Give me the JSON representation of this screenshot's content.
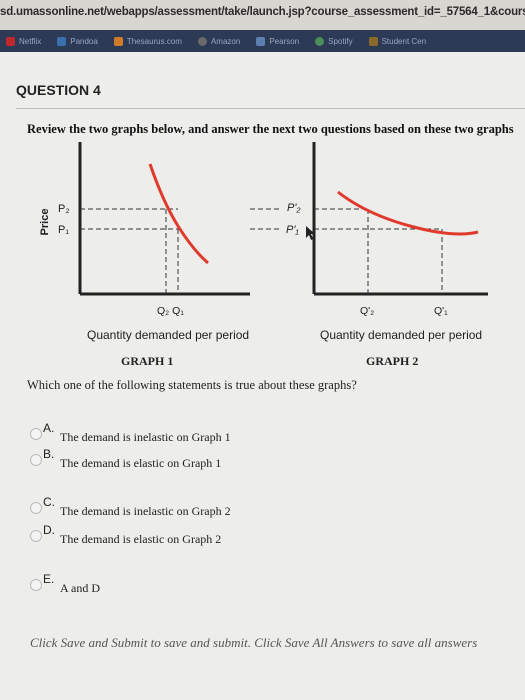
{
  "browser": {
    "url": "sd.umassonline.net/webapps/assessment/take/launch.jsp?course_assessment_id=_57564_1&cours",
    "bookmarks": [
      {
        "label": "Netflix",
        "icon": "netflix-icon",
        "color": "#c0282e"
      },
      {
        "label": "Pandoa",
        "icon": "pandora-icon",
        "color": "#3a6fb0"
      },
      {
        "label": "Thesaurus.com",
        "icon": "thesaurus-icon",
        "color": "#d07b2a"
      },
      {
        "label": "Amazon",
        "icon": "amazon-icon",
        "color": "#6a6a6a"
      },
      {
        "label": "Pearson",
        "icon": "pearson-icon",
        "color": "#5a7fb0"
      },
      {
        "label": "Spotify",
        "icon": "spotify-icon",
        "color": "#4a8f5a"
      },
      {
        "label": "Student Cen",
        "icon": "umass-icon",
        "color": "#8a6a2a"
      }
    ]
  },
  "question": {
    "header": "QUESTION 4",
    "prompt": "Review the two graphs below, and answer the next two questions based on these two graphs",
    "text": "Which one of the following statements is true about these graphs?"
  },
  "graph1": {
    "title": "GRAPH 1",
    "ylabel": "Price",
    "xlabel": "Quantity demanded per period",
    "p2": "P₂",
    "p1": "P₁",
    "q_labels": "Q₂ Q₁"
  },
  "graph2": {
    "title": "GRAPH 2",
    "xlabel": "Quantity demanded per period",
    "p2": "P'₂",
    "p1": "P'₁",
    "q2": "Q'₂",
    "q1": "Q'₁"
  },
  "options": [
    {
      "letter": "A.",
      "text": "The demand is inelastic on Graph 1"
    },
    {
      "letter": "B.",
      "text": "The demand is elastic on Graph 1"
    },
    {
      "letter": "C.",
      "text": "The demand is inelastic on Graph 2"
    },
    {
      "letter": "D.",
      "text": "The demand is elastic on Graph 2"
    },
    {
      "letter": "E.",
      "text": "A and D"
    }
  ],
  "footer": "Click Save and Submit to save and submit. Click Save All Answers to save all answers",
  "colors": {
    "curve": "#e03a2c",
    "axis": "#222222"
  }
}
